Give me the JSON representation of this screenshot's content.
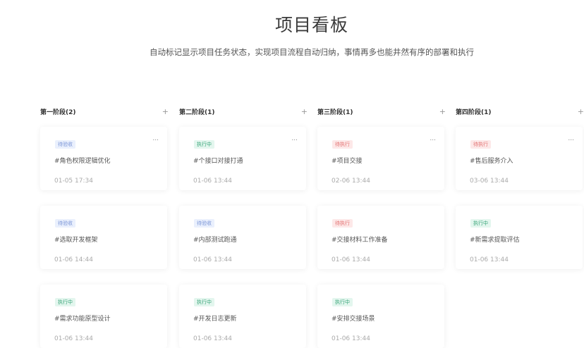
{
  "header": {
    "title": "项目看板",
    "subtitle": "自动标记显示项目任务状态，实现项目流程自动归纳，事情再多也能井然有序的部署和执行"
  },
  "columns": [
    {
      "title": "第一阶段(2)",
      "add": "+",
      "cards": [
        {
          "status": "待验收",
          "title": "#角色权限逻辑优化",
          "time": "01-05 17:34",
          "more": "..."
        },
        {
          "status": "待验收",
          "title": "#选取开发框架",
          "time": "01-06 14:44",
          "more": ""
        },
        {
          "status": "执行中",
          "title": "#需求功能原型设计",
          "time": "01-06 13:44",
          "more": ""
        }
      ]
    },
    {
      "title": "第二阶段(1)",
      "add": "+",
      "cards": [
        {
          "status": "执行中",
          "title": "#个接口对接打通",
          "time": "01-06 13:44",
          "more": "..."
        },
        {
          "status": "待验收",
          "title": "#内部测试跑通",
          "time": "01-06 13:44",
          "more": ""
        },
        {
          "status": "执行中",
          "title": "#开发日志更新",
          "time": "01-06 13:44",
          "more": ""
        }
      ]
    },
    {
      "title": "第三阶段(1)",
      "add": "+",
      "cards": [
        {
          "status": "待执行",
          "title": "#项目交接",
          "time": "02-06 13:44",
          "more": "..."
        },
        {
          "status": "待执行",
          "title": "#交接材料工作准备",
          "time": "01-06 13:44",
          "more": ""
        },
        {
          "status": "执行中",
          "title": "#安排交接场景",
          "time": "01-06 13:44",
          "more": ""
        }
      ]
    },
    {
      "title": "第四阶段(1)",
      "add": "+",
      "cards": [
        {
          "status": "待执行",
          "title": "#售后服务介入",
          "time": "03-06 13:44",
          "more": "..."
        },
        {
          "status": "执行中",
          "title": "#新需求提取评估",
          "time": "01-06 13:44",
          "more": ""
        }
      ]
    }
  ],
  "status_colors": {
    "待验收": {
      "bg": "#eaf0fd",
      "fg": "#7b95d6"
    },
    "执行中": {
      "bg": "#e3f6ee",
      "fg": "#3aa579"
    },
    "待执行": {
      "bg": "#fde8e8",
      "fg": "#e27070"
    }
  }
}
